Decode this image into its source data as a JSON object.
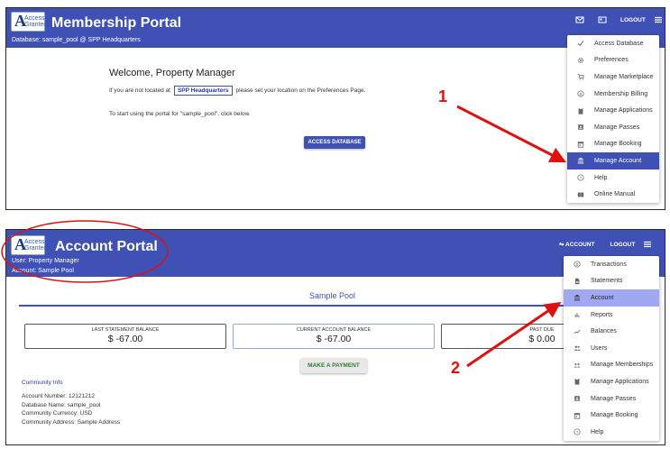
{
  "panel1": {
    "title": "Membership Portal",
    "database_line": "Database: sample_pool @ SPP Headquarters",
    "logo_text": "Access Granted",
    "logo_letter": "A",
    "logout": "LOGOUT",
    "welcome": "Welcome, Property Manager",
    "location_prefix": "If you are not located at",
    "location_name": "SPP Headquarters",
    "location_suffix": "please set your location on the Preferences Page.",
    "start_text": "To start using the portal for \"sample_pool\", click below.",
    "access_button": "ACCESS DATABASE",
    "menu": [
      {
        "label": "Access Database",
        "icon": "check-icon"
      },
      {
        "label": "Preferences",
        "icon": "gear-icon"
      },
      {
        "label": "Manage Marketplace",
        "icon": "cart-icon"
      },
      {
        "label": "Membership Billing",
        "icon": "dollar-icon"
      },
      {
        "label": "Manage Applications",
        "icon": "clipboard-icon"
      },
      {
        "label": "Manage Passes",
        "icon": "badge-icon"
      },
      {
        "label": "Manage Booking",
        "icon": "calendar-icon"
      },
      {
        "label": "Manage Account",
        "icon": "bank-icon",
        "state": "active"
      },
      {
        "label": "Help",
        "icon": "help-icon"
      },
      {
        "label": "Online Manual",
        "icon": "book-icon"
      }
    ]
  },
  "panel2": {
    "title": "Account Portal",
    "user_line": "User: Property Manager",
    "account_line": "Account: Sample Pool",
    "logo_text": "Access Granted",
    "logo_letter": "A",
    "account_link": "ACCOUNT",
    "logout": "LOGOUT",
    "pool_title": "Sample Pool",
    "cards": [
      {
        "label": "LAST STATEMENT BALANCE",
        "value": "$ -67.00"
      },
      {
        "label": "CURRENT ACCOUNT BALANCE",
        "value": "$ -67.00"
      },
      {
        "label": "PAST DUE",
        "value": "$ 0.00"
      }
    ],
    "pay_button": "MAKE A PAYMENT",
    "community_info_title": "Community Info",
    "details": {
      "account_number": "Account Number: 12121212",
      "database_name": "Database Name: sample_pool",
      "currency": "Community Currency: USD",
      "address": "Community Address: Sample Address"
    },
    "menu": [
      {
        "label": "Transactions",
        "icon": "dollar-icon"
      },
      {
        "label": "Statements",
        "icon": "document-icon"
      },
      {
        "label": "Account",
        "icon": "bank-icon",
        "state": "highlighted"
      },
      {
        "label": "Reports",
        "icon": "bar-chart-icon"
      },
      {
        "label": "Balances",
        "icon": "trend-icon"
      },
      {
        "label": "Users",
        "icon": "users-icon"
      },
      {
        "label": "Manage Memberships",
        "icon": "group-icon"
      },
      {
        "label": "Manage Applications",
        "icon": "clipboard-icon"
      },
      {
        "label": "Manage Passes",
        "icon": "badge-icon"
      },
      {
        "label": "Manage Booking",
        "icon": "calendar-icon"
      },
      {
        "label": "Help",
        "icon": "help-icon"
      }
    ]
  },
  "annotations": {
    "step1": "1",
    "step2": "2"
  },
  "colors": {
    "header": "#3f51b5",
    "annotation": "#e01010",
    "menu_active": "#3f51b5",
    "menu_highlight": "#9fa8f0"
  }
}
